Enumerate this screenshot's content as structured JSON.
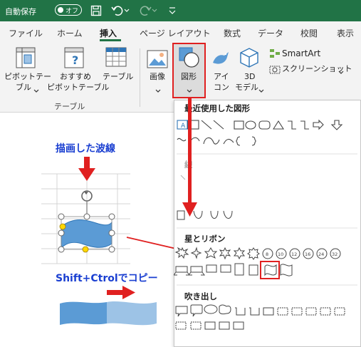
{
  "titlebar": {
    "autosave_label": "自動保存",
    "toggle_state": "オフ"
  },
  "tabs": [
    "ファイル",
    "ホーム",
    "挿入",
    "ページ レイアウト",
    "数式",
    "データ",
    "校閲",
    "表示"
  ],
  "active_tab": "挿入",
  "ribbon": {
    "pivot_label_1": "ピボットテー",
    "pivot_label_2": "ブル",
    "recommended_label_1": "おすすめ",
    "recommended_label_2": "ピボットテーブル",
    "table_label": "テーブル",
    "table_group_label": "テーブル",
    "image_label": "画像",
    "shapes_label": "図形",
    "icons_label_1": "アイ",
    "icons_label_2": "コン",
    "model3d_label_1": "3D",
    "model3d_label_2": "モデル",
    "smartart_label": "SmartArt",
    "screenshot_label": "スクリーンショット"
  },
  "dropdown": {
    "recent_title": "最近使用した図形",
    "lines_title": "線",
    "stars_title": "星とリボン",
    "callouts_title": "吹き出し",
    "textbox_label": "A"
  },
  "annotations": {
    "wave_title": "描画した波線",
    "copy_title": "Shift+Ctrolでコピー"
  },
  "colors": {
    "excel_green": "#217346",
    "highlight_red": "#e02020",
    "annotation_blue": "#1a3fd1",
    "wave_blue": "#5b9bd5"
  }
}
